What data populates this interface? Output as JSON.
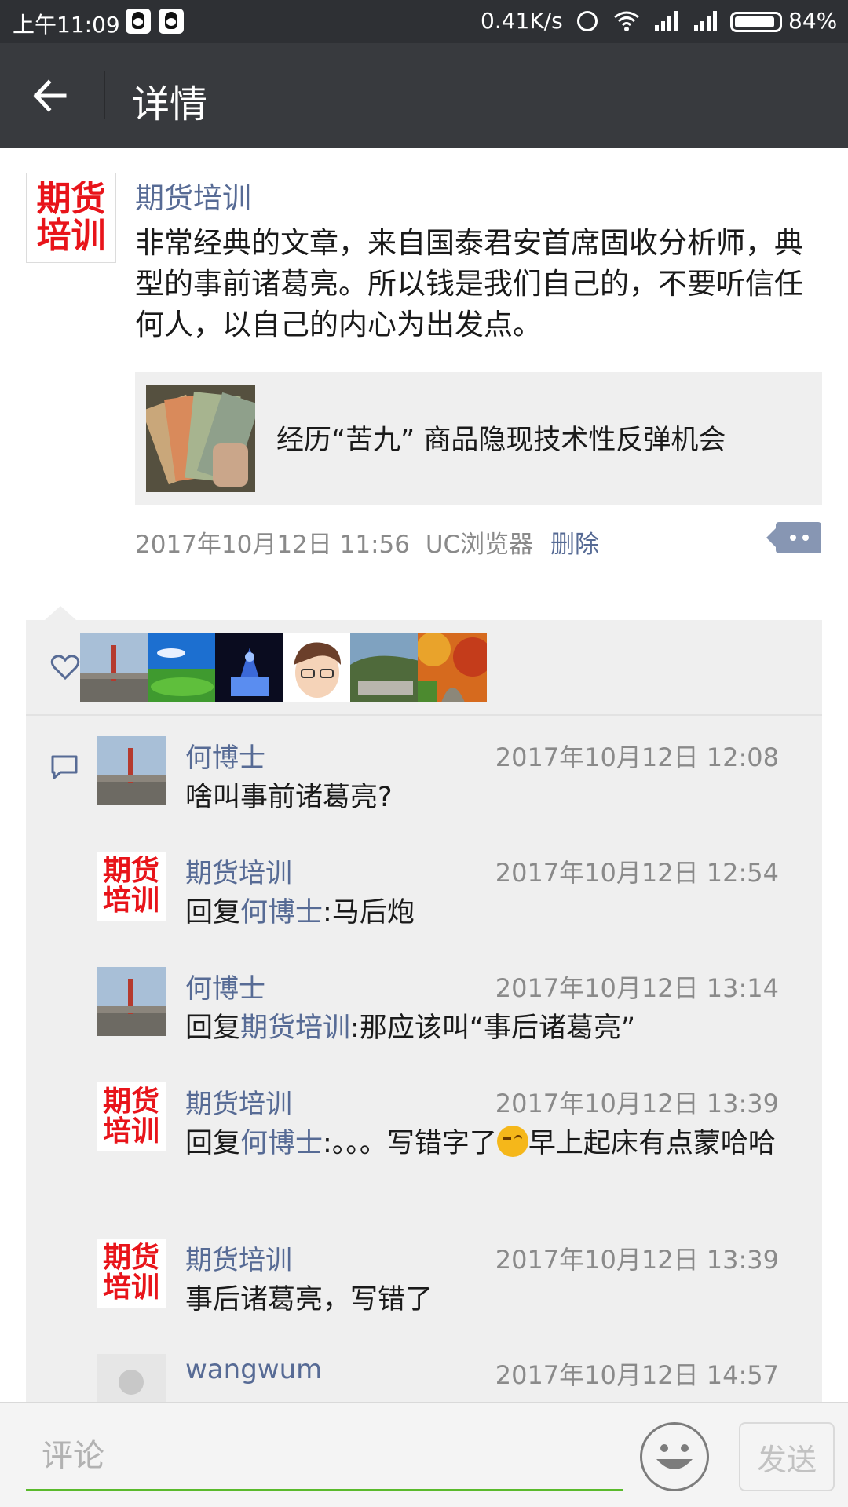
{
  "status_bar": {
    "time": "上午11:09",
    "net_speed": "0.41K/s",
    "battery": "84%",
    "notification_icons": [
      "qq-icon",
      "qq-icon"
    ]
  },
  "header": {
    "title": "详情",
    "back_icon": "arrow-left-icon"
  },
  "post": {
    "author": "期货培训",
    "avatar_text": [
      "期货",
      "培训"
    ],
    "text": "非常经典的文章，来自国泰君安首席固收分析师，典型的事前诸葛亮。所以钱是我们自己的，不要听信任何人，以自己的内心为出发点。",
    "link_title": "经历“苦九” 商品隐现技术性反弹机会",
    "time": "2017年10月12日 11:56",
    "source": "UC浏览器",
    "delete_label": "删除"
  },
  "likes": {
    "icon": "heart-icon",
    "avatars": [
      "avatar-wall",
      "avatar-lake",
      "avatar-castle",
      "avatar-cartoon",
      "avatar-mountain",
      "avatar-autumn"
    ]
  },
  "comments": [
    {
      "author": "何博士",
      "time": "2017年10月12日 12:08",
      "text": "啥叫事前诸葛亮?",
      "reply_to": "",
      "after": ""
    },
    {
      "author": "期货培训",
      "time": "2017年10月12日 12:54",
      "text": "",
      "reply_prefix": "回复",
      "reply_to": "何博士",
      "after": ":马后炮"
    },
    {
      "author": "何博士",
      "time": "2017年10月12日 13:14",
      "text": "",
      "reply_prefix": "回复",
      "reply_to": "期货培训",
      "after": ":那应该叫“事后诸葛亮”"
    },
    {
      "author": "期货培训",
      "time": "2017年10月12日 13:39",
      "text": "",
      "reply_prefix": "回复",
      "reply_to": "何博士",
      "after": ":。。。写错字了",
      "after2": "早上起床有点蒙哈哈"
    },
    {
      "author": "期货培训",
      "time": "2017年10月12日 13:39",
      "text": "事后诸葛亮，写错了",
      "reply_to": "",
      "after": ""
    },
    {
      "author": "wangwum",
      "time": "2017年10月12日 14:57",
      "text": "",
      "reply_to": "",
      "after": ""
    }
  ],
  "bottom_bar": {
    "placeholder": "评论",
    "send_label": "发送"
  },
  "colors": {
    "link_blue": "#576b95",
    "header_bg": "#383a3e",
    "status_bg": "#2e3034",
    "panel_bg": "#efefef",
    "input_underline": "#5aba2c",
    "logo_red": "#e8141a"
  }
}
